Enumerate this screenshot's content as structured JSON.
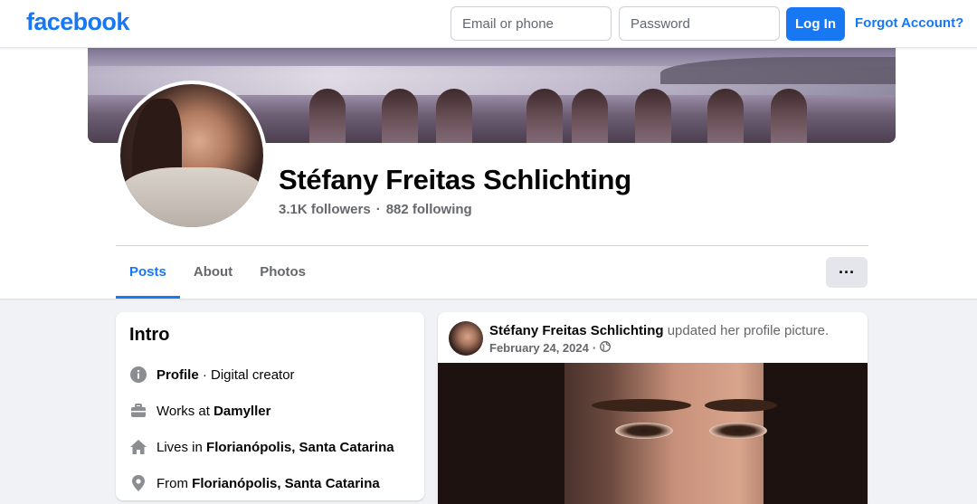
{
  "brand": {
    "logo_text": "facebook",
    "color": "#1877f2"
  },
  "login": {
    "email_placeholder": "Email or phone",
    "password_placeholder": "Password",
    "login_label": "Log In",
    "forgot_label": "Forgot Account?"
  },
  "profile": {
    "name": "Stéfany Freitas Schlichting",
    "followers": "3.1K followers",
    "separator": "·",
    "following": "882 following"
  },
  "tabs": [
    {
      "label": "Posts",
      "active": true
    },
    {
      "label": "About",
      "active": false
    },
    {
      "label": "Photos",
      "active": false
    }
  ],
  "more_button": {
    "label": "···"
  },
  "intro": {
    "title": "Intro",
    "rows": [
      {
        "icon": "info-icon",
        "bold": "Profile",
        "text": " · Digital creator"
      },
      {
        "icon": "briefcase-icon",
        "prefix": "Works at ",
        "bold": "Damyller"
      },
      {
        "icon": "home-icon",
        "prefix": "Lives in ",
        "bold": "Florianópolis, Santa Catarina"
      },
      {
        "icon": "location-pin-icon",
        "prefix": "From ",
        "bold": "Florianópolis, Santa Catarina"
      }
    ]
  },
  "post": {
    "author": "Stéfany Freitas Schlichting",
    "action": " updated her profile picture.",
    "date": "February 24, 2024",
    "separator": "·",
    "audience_icon": "globe-icon"
  }
}
